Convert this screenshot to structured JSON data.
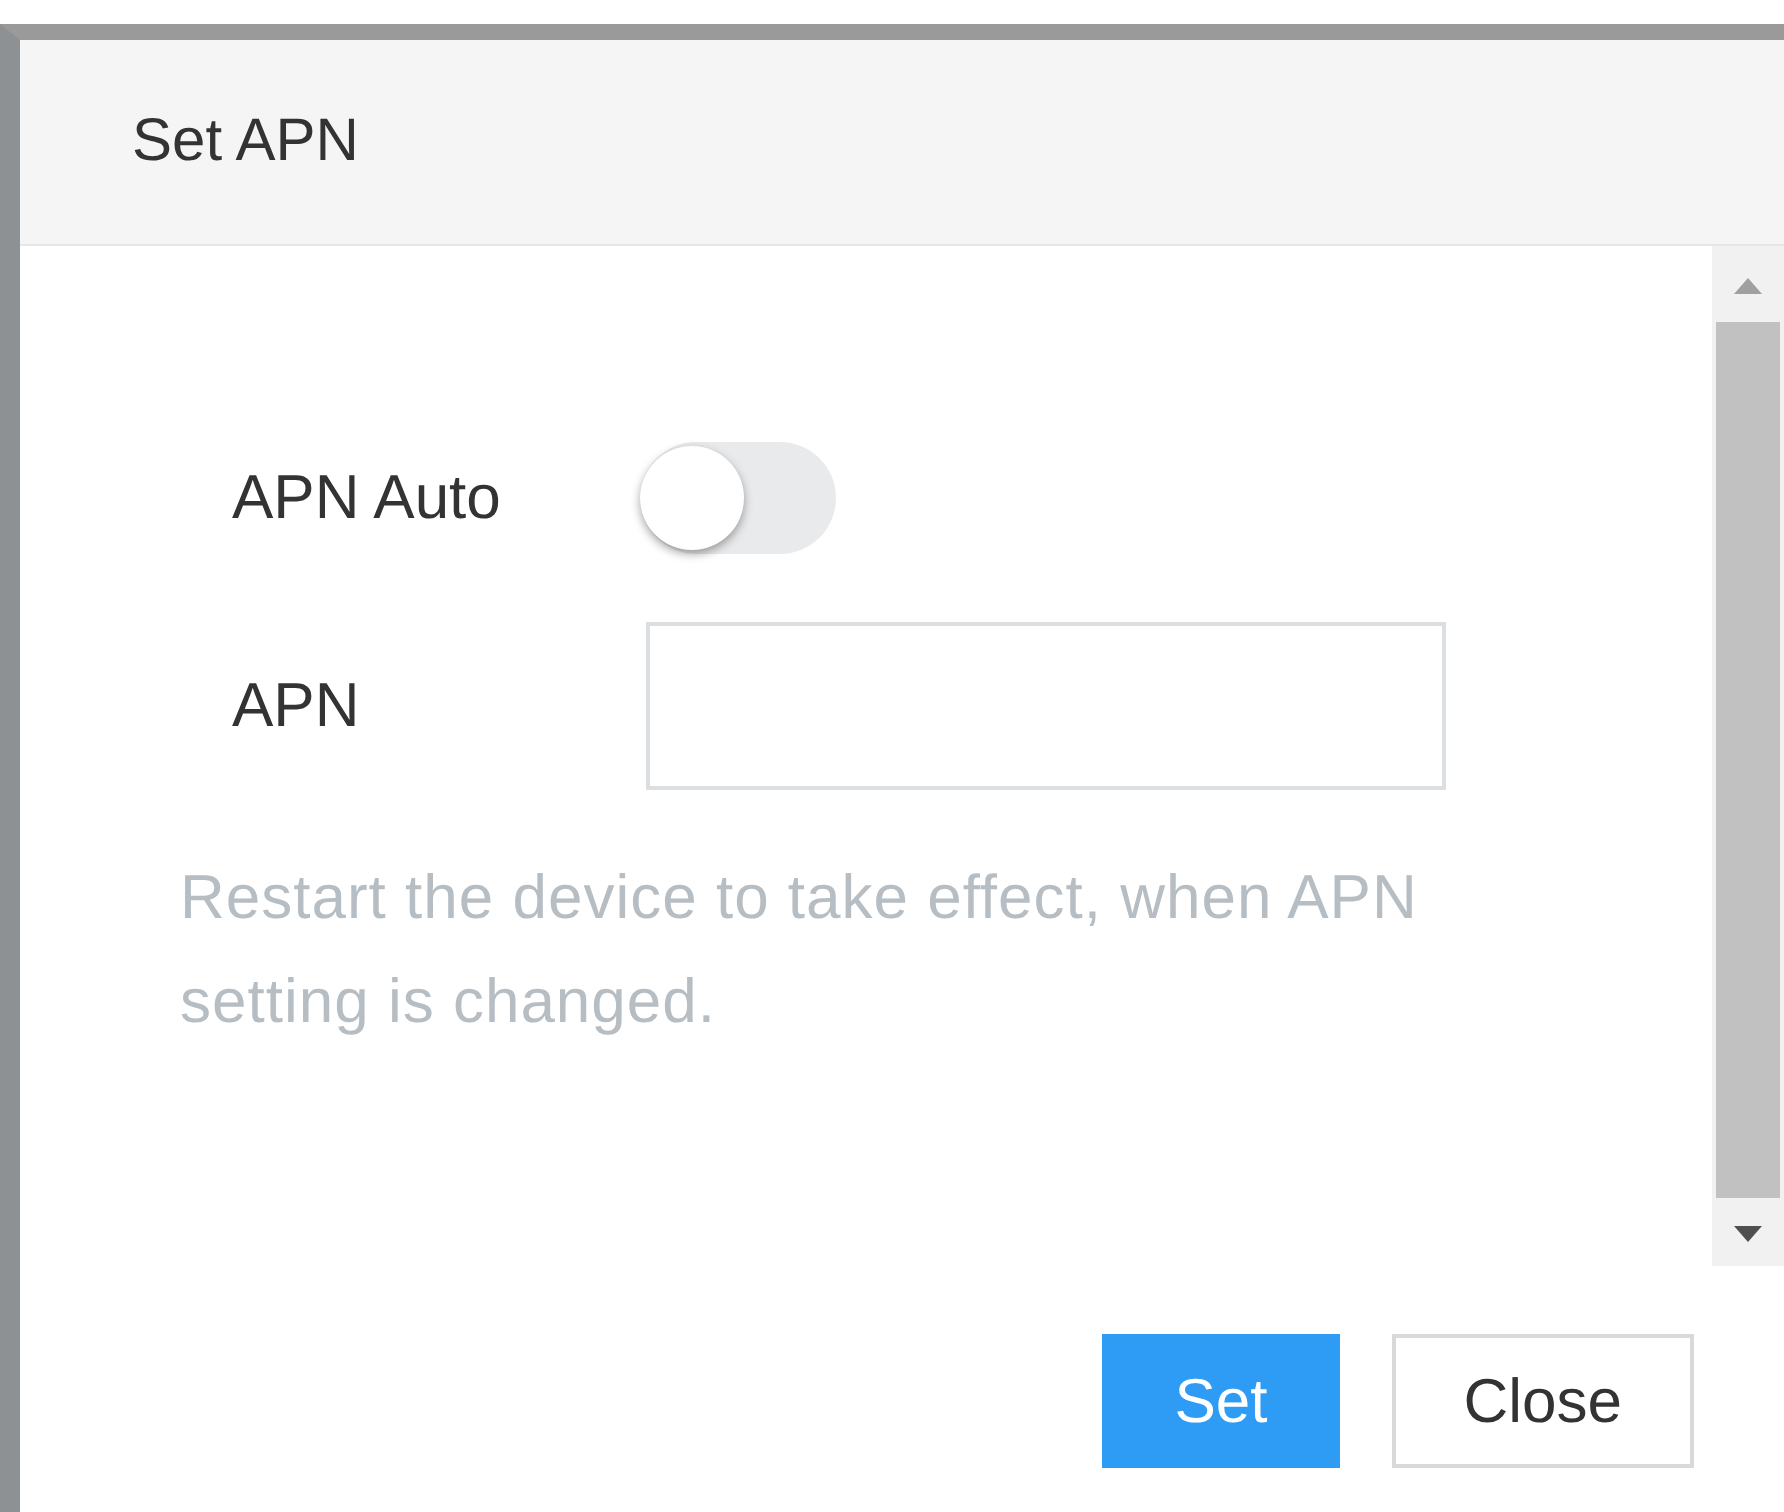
{
  "dialog": {
    "title": "Set APN"
  },
  "fields": [
    {
      "kind": "toggle",
      "label": "APN Auto",
      "on": false
    },
    {
      "kind": "text",
      "label": "APN"
    }
  ],
  "note": "Restart the device to take effect, when APN setting is changed.",
  "buttons": [
    {
      "label": "Set",
      "primary": true
    },
    {
      "label": "Close",
      "primary": false
    }
  ]
}
